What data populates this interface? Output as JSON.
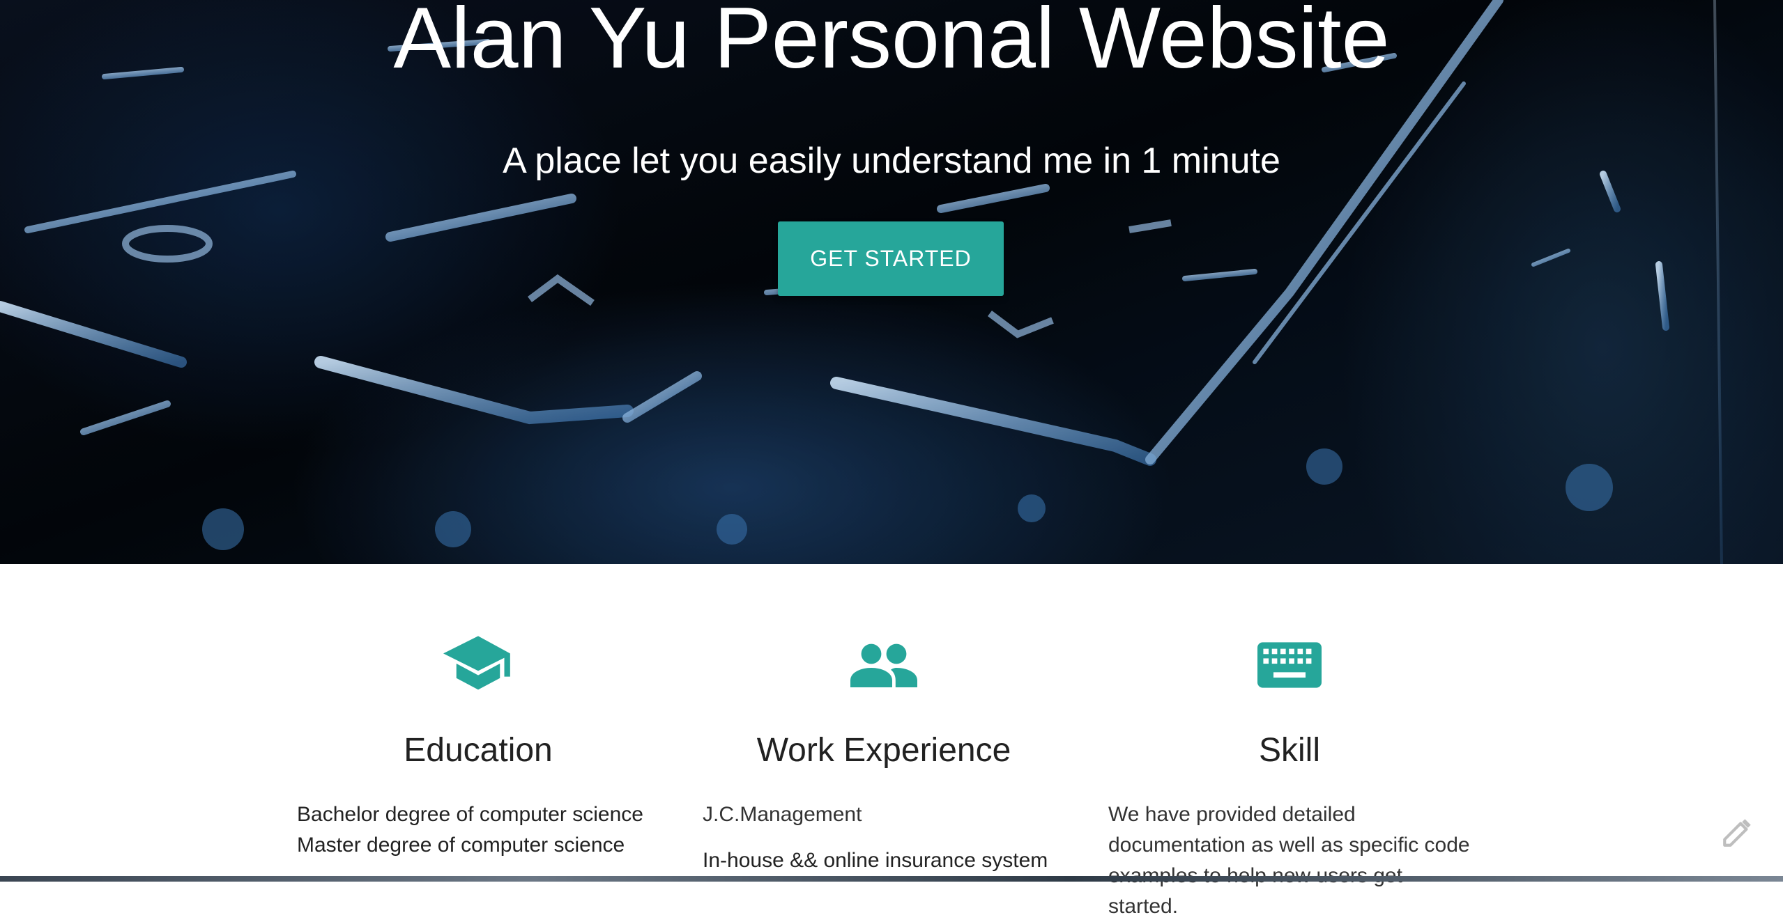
{
  "hero": {
    "title": "Alan Yu Personal Website",
    "subtitle": "A place let you easily understand me in 1 minute",
    "cta_label": "GET STARTED"
  },
  "features": {
    "education": {
      "icon": "graduation-cap-icon",
      "title": "Education",
      "lines": [
        "Bachelor degree of computer science",
        "Master degree of computer science"
      ]
    },
    "work": {
      "icon": "people-icon",
      "title": "Work Experience",
      "company": "J.C.Management",
      "project": "In-house && online insurance system"
    },
    "skill": {
      "icon": "keyboard-icon",
      "title": "Skill",
      "text": "We have provided detailed documentation as well as specific code examples to help new users get started."
    }
  },
  "colors": {
    "accent": "#26a69a",
    "text": "#212121",
    "hero_text": "#ffffff"
  }
}
